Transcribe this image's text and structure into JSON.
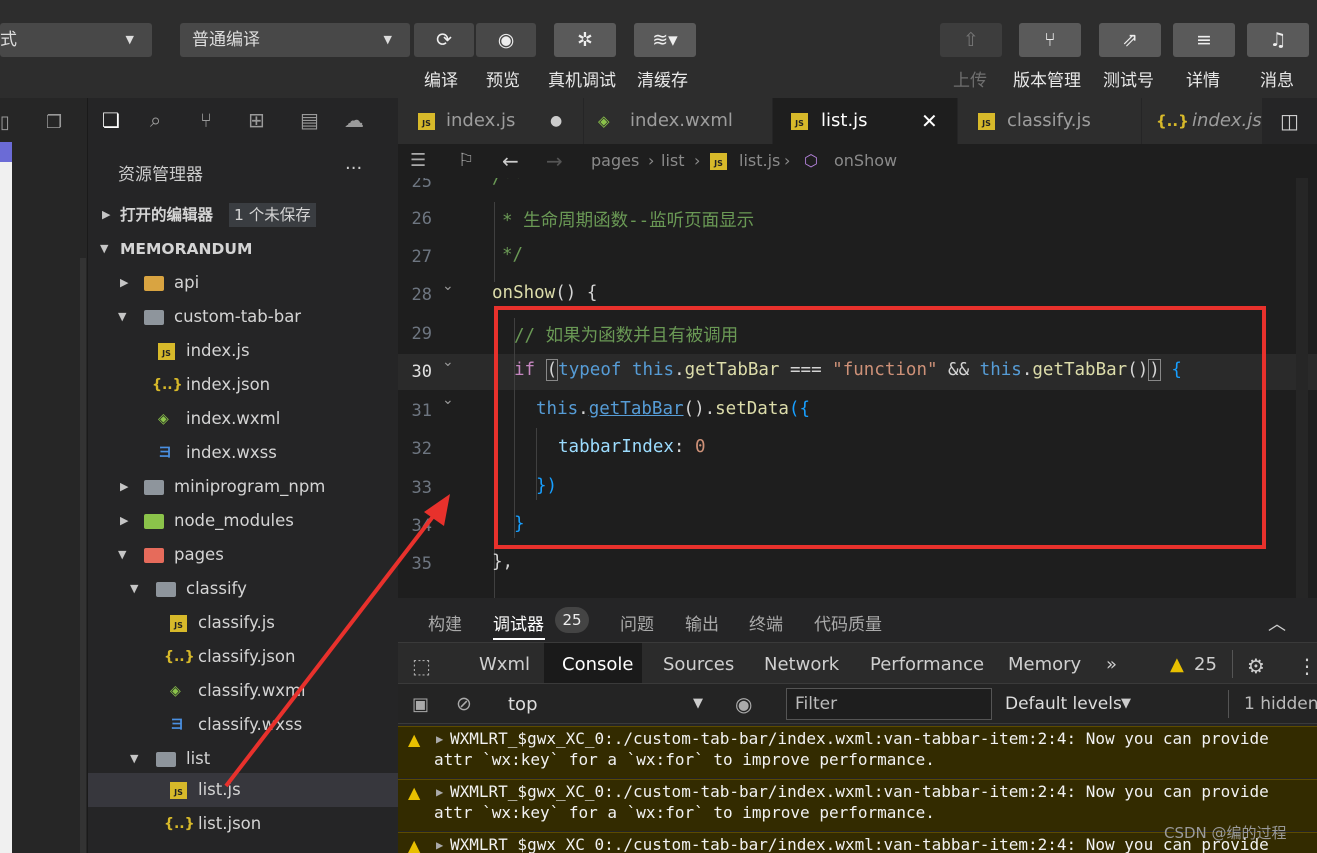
{
  "toolbar": {
    "mode_select": "式",
    "compile_select": "普通编译",
    "buttons": [
      {
        "icon": "refresh-icon",
        "label": "编译"
      },
      {
        "icon": "eye-icon",
        "label": "预览"
      },
      {
        "icon": "bug-icon",
        "label": "真机调试"
      },
      {
        "icon": "layers-icon",
        "label": "清缓存"
      }
    ],
    "right_buttons": [
      {
        "icon": "upload-icon",
        "label": "上传"
      },
      {
        "icon": "branch-icon",
        "label": "版本管理"
      },
      {
        "icon": "external-link-icon",
        "label": "测试号"
      },
      {
        "icon": "menu-icon",
        "label": "详情"
      },
      {
        "icon": "bell-icon",
        "label": "消息"
      }
    ]
  },
  "explorer": {
    "title": "资源管理器",
    "more": "···",
    "open_editors": "打开的编辑器",
    "unsaved_badge": "1 个未保存",
    "project": "MEMORANDUM",
    "tree": [
      {
        "label": "api",
        "type": "folder-api"
      },
      {
        "label": "custom-tab-bar",
        "type": "folder-open"
      },
      {
        "label": "index.js",
        "type": "js"
      },
      {
        "label": "index.json",
        "type": "json"
      },
      {
        "label": "index.wxml",
        "type": "wxml"
      },
      {
        "label": "index.wxss",
        "type": "wxss"
      },
      {
        "label": "miniprogram_npm",
        "type": "folder"
      },
      {
        "label": "node_modules",
        "type": "folder-node"
      },
      {
        "label": "pages",
        "type": "folder-pages"
      },
      {
        "label": "classify",
        "type": "folder-open"
      },
      {
        "label": "classify.js",
        "type": "js"
      },
      {
        "label": "classify.json",
        "type": "json"
      },
      {
        "label": "classify.wxml",
        "type": "wxml"
      },
      {
        "label": "classify.wxss",
        "type": "wxss"
      },
      {
        "label": "list",
        "type": "folder-open"
      },
      {
        "label": "list.js",
        "type": "js"
      },
      {
        "label": "list.json",
        "type": "json"
      }
    ]
  },
  "tabs": [
    {
      "label": "index.js",
      "type": "js"
    },
    {
      "label": "index.wxml",
      "type": "wxml"
    },
    {
      "label": "list.js",
      "type": "js"
    },
    {
      "label": "classify.js",
      "type": "js"
    },
    {
      "label": "index.js",
      "type": "json"
    }
  ],
  "breadcrumb": {
    "p1": "pages",
    "p2": "list",
    "p3": "list.js",
    "p4": "onShow"
  },
  "editor": {
    "lines": [
      "25",
      "26",
      "27",
      "28",
      "29",
      "30",
      "31",
      "32",
      "33",
      "34",
      "35"
    ],
    "c26": "* 生命周期函数--监听页面显示",
    "c27": "*/",
    "c28a": "onShow",
    "c28b": "() {",
    "c29": "// 如果为函数并且有被调用",
    "c31a": "this",
    "c31b": ".",
    "c31c": "getTabBar",
    "c31d": "().",
    "c31e": "setData",
    "c31f": "({",
    "c32a": "tabbarIndex",
    "c32b": ": ",
    "c32c": "0",
    "c33": "})",
    "c34": "}",
    "c35": "},"
  },
  "panel": {
    "tabs": [
      "构建",
      "调试器",
      "问题",
      "输出",
      "终端",
      "代码质量"
    ],
    "debug_badge": "25",
    "devtools_tabs": [
      "Wxml",
      "Console",
      "Sources",
      "Network",
      "Performance",
      "Memory"
    ],
    "more": "»",
    "warn_count": "25",
    "context": "top",
    "filter_placeholder": "Filter",
    "levels": "Default levels",
    "hidden": "1 hidden",
    "log_line1": "WXMLRT_$gwx_XC_0:./custom-tab-bar/index.wxml:van-tabbar-item:2:4: Now you can provide",
    "log_line2": "attr `wx:key` for a `wx:for` to improve performance."
  },
  "watermark": "CSDN @编的过程",
  "colors": {
    "highlight": "#e8312c",
    "warning": "#e8c000"
  }
}
